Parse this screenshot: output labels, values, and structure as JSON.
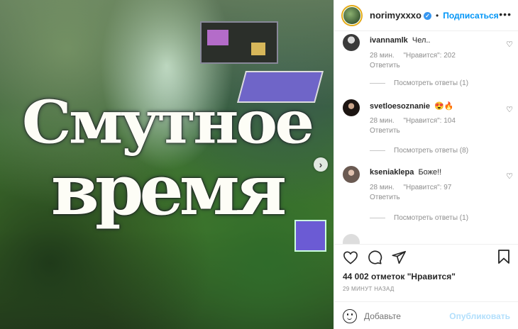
{
  "post": {
    "headline_line1": "Смутное",
    "headline_line2": "время",
    "next_icon": "chevron-right-icon"
  },
  "header": {
    "username": "norimyxxxo",
    "verified_icon": "verified-badge-icon",
    "separator": "•",
    "follow_label": "Подписаться",
    "more_icon": "more-horizontal-icon"
  },
  "comments": [
    {
      "username": "ivannamlk",
      "text": "Чел..",
      "time": "28 мин.",
      "likes": "\"Нравится\": 202",
      "reply": "Ответить",
      "view_replies": "Посмотреть ответы (1)",
      "avatar_color": "#3a3a3a"
    },
    {
      "username": "svetloesoznanie",
      "text": "😍🔥",
      "time": "28 мин.",
      "likes": "\"Нравится\": 104",
      "reply": "Ответить",
      "view_replies": "Посмотреть ответы (8)",
      "avatar_color": "#2b2420"
    },
    {
      "username": "kseniaklepa",
      "text": "Боже!!",
      "time": "28 мин.",
      "likes": "\"Нравится\": 97",
      "reply": "Ответить",
      "view_replies": "Посмотреть ответы (1)",
      "avatar_color": "#6a5a52"
    }
  ],
  "actions": {
    "likes_count": "44 002 отметок \"Нравится\"",
    "posted_time": "29 МИНУТ НАЗАД",
    "comment_placeholder": "Добавьте",
    "publish_label": "Опубликовать"
  },
  "colors": {
    "accent": "#0095f6",
    "publish_disabled": "#b2dffc",
    "muted": "#8e8e8e"
  }
}
